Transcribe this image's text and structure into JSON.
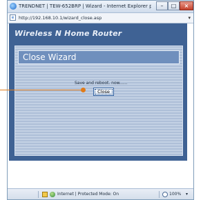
{
  "window": {
    "title": "TRENDNET | TEW-652BRP | Wizard - Internet Explorer provided b...",
    "minimize_glyph": "–",
    "maximize_glyph": "□",
    "close_glyph": "×"
  },
  "address_bar": {
    "url": "http://192.168.10.1/wizard_close.asp",
    "dropdown_glyph": "▾"
  },
  "router": {
    "header": "Wireless N Home Router"
  },
  "wizard": {
    "title": "Close Wizard",
    "message": "Save and reboot. now......",
    "close_button_label": "Close"
  },
  "status_bar": {
    "zone": "Internet | Protected Mode: On",
    "zoom": "100%",
    "zoom_dropdown_glyph": "▾"
  },
  "colors": {
    "router_panel": "#3f6294",
    "wizard_title_bar": "#6f8fbd",
    "pointer": "#e07b1a"
  },
  "icons": {
    "title": "internet-explorer-icon",
    "address": "page-icon",
    "status_document": "document-icon",
    "status_zone": "globe-icon",
    "status_zoom": "zoom-icon"
  }
}
